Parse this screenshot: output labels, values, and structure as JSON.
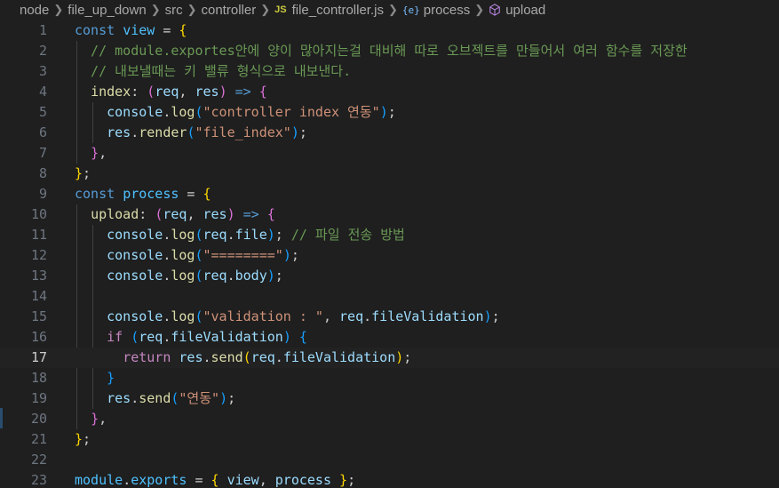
{
  "breadcrumb": {
    "items": [
      "node",
      "file_up_down",
      "src",
      "controller"
    ],
    "file_badge": "JS",
    "file_name": "file_controller.js",
    "symbol_icon": "{e}",
    "symbol1": "process",
    "symbol2": "upload"
  },
  "colors": {
    "background": "#1f1f1f",
    "keyword": "#569cd6",
    "variable": "#9cdcfe",
    "function": "#dcdcaa",
    "string": "#ce9178",
    "comment": "#6a9955",
    "bracket_gold": "#ffd700",
    "bracket_pink": "#da70d6",
    "bracket_blue": "#179fff",
    "flow_keyword": "#c586c0",
    "js_badge": "#cbcb41"
  },
  "editor": {
    "current_line": 17,
    "lines": [
      {
        "n": "1",
        "tokens": [
          {
            "t": "const",
            "c": "#569cd6"
          },
          {
            "t": " ",
            "c": "#cccccc"
          },
          {
            "t": "view",
            "c": "#4fc1ff"
          },
          {
            "t": " = ",
            "c": "#cccccc"
          },
          {
            "t": "{",
            "c": "#ffd700"
          }
        ]
      },
      {
        "n": "2",
        "tokens": [
          {
            "t": "  // module.exportes안에 양이 많아지는걸 대비해 따로 오브젝트를 만들어서 여러 함수를 저장한",
            "c": "#6a9955"
          }
        ]
      },
      {
        "n": "3",
        "tokens": [
          {
            "t": "  // 내보낼때는 키 밸류 형식으로 내보낸다.",
            "c": "#6a9955"
          }
        ]
      },
      {
        "n": "4",
        "tokens": [
          {
            "t": "  ",
            "c": "#cccccc"
          },
          {
            "t": "index",
            "c": "#dcdcaa"
          },
          {
            "t": ": ",
            "c": "#cccccc"
          },
          {
            "t": "(",
            "c": "#da70d6"
          },
          {
            "t": "req",
            "c": "#9cdcfe"
          },
          {
            "t": ", ",
            "c": "#cccccc"
          },
          {
            "t": "res",
            "c": "#9cdcfe"
          },
          {
            "t": ")",
            "c": "#da70d6"
          },
          {
            "t": " ",
            "c": "#cccccc"
          },
          {
            "t": "=>",
            "c": "#569cd6"
          },
          {
            "t": " ",
            "c": "#cccccc"
          },
          {
            "t": "{",
            "c": "#da70d6"
          }
        ]
      },
      {
        "n": "5",
        "tokens": [
          {
            "t": "    ",
            "c": "#cccccc"
          },
          {
            "t": "console",
            "c": "#9cdcfe"
          },
          {
            "t": ".",
            "c": "#cccccc"
          },
          {
            "t": "log",
            "c": "#dcdcaa"
          },
          {
            "t": "(",
            "c": "#179fff"
          },
          {
            "t": "\"controller index 연동\"",
            "c": "#ce9178"
          },
          {
            "t": ")",
            "c": "#179fff"
          },
          {
            "t": ";",
            "c": "#cccccc"
          }
        ]
      },
      {
        "n": "6",
        "tokens": [
          {
            "t": "    ",
            "c": "#cccccc"
          },
          {
            "t": "res",
            "c": "#9cdcfe"
          },
          {
            "t": ".",
            "c": "#cccccc"
          },
          {
            "t": "render",
            "c": "#dcdcaa"
          },
          {
            "t": "(",
            "c": "#179fff"
          },
          {
            "t": "\"file_index\"",
            "c": "#ce9178"
          },
          {
            "t": ")",
            "c": "#179fff"
          },
          {
            "t": ";",
            "c": "#cccccc"
          }
        ]
      },
      {
        "n": "7",
        "tokens": [
          {
            "t": "  ",
            "c": "#cccccc"
          },
          {
            "t": "}",
            "c": "#da70d6"
          },
          {
            "t": ",",
            "c": "#cccccc"
          }
        ]
      },
      {
        "n": "8",
        "tokens": [
          {
            "t": "}",
            "c": "#ffd700"
          },
          {
            "t": ";",
            "c": "#cccccc"
          }
        ]
      },
      {
        "n": "9",
        "tokens": [
          {
            "t": "const",
            "c": "#569cd6"
          },
          {
            "t": " ",
            "c": "#cccccc"
          },
          {
            "t": "process",
            "c": "#4fc1ff"
          },
          {
            "t": " = ",
            "c": "#cccccc"
          },
          {
            "t": "{",
            "c": "#ffd700"
          }
        ]
      },
      {
        "n": "10",
        "tokens": [
          {
            "t": "  ",
            "c": "#cccccc"
          },
          {
            "t": "upload",
            "c": "#dcdcaa"
          },
          {
            "t": ": ",
            "c": "#cccccc"
          },
          {
            "t": "(",
            "c": "#da70d6"
          },
          {
            "t": "req",
            "c": "#9cdcfe"
          },
          {
            "t": ", ",
            "c": "#cccccc"
          },
          {
            "t": "res",
            "c": "#9cdcfe"
          },
          {
            "t": ")",
            "c": "#da70d6"
          },
          {
            "t": " ",
            "c": "#cccccc"
          },
          {
            "t": "=>",
            "c": "#569cd6"
          },
          {
            "t": " ",
            "c": "#cccccc"
          },
          {
            "t": "{",
            "c": "#da70d6"
          }
        ]
      },
      {
        "n": "11",
        "tokens": [
          {
            "t": "    ",
            "c": "#cccccc"
          },
          {
            "t": "console",
            "c": "#9cdcfe"
          },
          {
            "t": ".",
            "c": "#cccccc"
          },
          {
            "t": "log",
            "c": "#dcdcaa"
          },
          {
            "t": "(",
            "c": "#179fff"
          },
          {
            "t": "req",
            "c": "#9cdcfe"
          },
          {
            "t": ".",
            "c": "#cccccc"
          },
          {
            "t": "file",
            "c": "#9cdcfe"
          },
          {
            "t": ")",
            "c": "#179fff"
          },
          {
            "t": "; ",
            "c": "#cccccc"
          },
          {
            "t": "// 파일 전송 방법",
            "c": "#6a9955"
          }
        ]
      },
      {
        "n": "12",
        "tokens": [
          {
            "t": "    ",
            "c": "#cccccc"
          },
          {
            "t": "console",
            "c": "#9cdcfe"
          },
          {
            "t": ".",
            "c": "#cccccc"
          },
          {
            "t": "log",
            "c": "#dcdcaa"
          },
          {
            "t": "(",
            "c": "#179fff"
          },
          {
            "t": "\"========\"",
            "c": "#ce9178"
          },
          {
            "t": ")",
            "c": "#179fff"
          },
          {
            "t": ";",
            "c": "#cccccc"
          }
        ]
      },
      {
        "n": "13",
        "tokens": [
          {
            "t": "    ",
            "c": "#cccccc"
          },
          {
            "t": "console",
            "c": "#9cdcfe"
          },
          {
            "t": ".",
            "c": "#cccccc"
          },
          {
            "t": "log",
            "c": "#dcdcaa"
          },
          {
            "t": "(",
            "c": "#179fff"
          },
          {
            "t": "req",
            "c": "#9cdcfe"
          },
          {
            "t": ".",
            "c": "#cccccc"
          },
          {
            "t": "body",
            "c": "#9cdcfe"
          },
          {
            "t": ")",
            "c": "#179fff"
          },
          {
            "t": ";",
            "c": "#cccccc"
          }
        ]
      },
      {
        "n": "14",
        "tokens": []
      },
      {
        "n": "15",
        "tokens": [
          {
            "t": "    ",
            "c": "#cccccc"
          },
          {
            "t": "console",
            "c": "#9cdcfe"
          },
          {
            "t": ".",
            "c": "#cccccc"
          },
          {
            "t": "log",
            "c": "#dcdcaa"
          },
          {
            "t": "(",
            "c": "#179fff"
          },
          {
            "t": "\"validation : \"",
            "c": "#ce9178"
          },
          {
            "t": ", ",
            "c": "#cccccc"
          },
          {
            "t": "req",
            "c": "#9cdcfe"
          },
          {
            "t": ".",
            "c": "#cccccc"
          },
          {
            "t": "fileValidation",
            "c": "#9cdcfe"
          },
          {
            "t": ")",
            "c": "#179fff"
          },
          {
            "t": ";",
            "c": "#cccccc"
          }
        ]
      },
      {
        "n": "16",
        "tokens": [
          {
            "t": "    ",
            "c": "#cccccc"
          },
          {
            "t": "if",
            "c": "#c586c0"
          },
          {
            "t": " ",
            "c": "#cccccc"
          },
          {
            "t": "(",
            "c": "#179fff"
          },
          {
            "t": "req",
            "c": "#9cdcfe"
          },
          {
            "t": ".",
            "c": "#cccccc"
          },
          {
            "t": "fileValidation",
            "c": "#9cdcfe"
          },
          {
            "t": ")",
            "c": "#179fff"
          },
          {
            "t": " ",
            "c": "#cccccc"
          },
          {
            "t": "{",
            "c": "#179fff"
          }
        ]
      },
      {
        "n": "17",
        "tokens": [
          {
            "t": "      ",
            "c": "#cccccc"
          },
          {
            "t": "return",
            "c": "#c586c0"
          },
          {
            "t": " ",
            "c": "#cccccc"
          },
          {
            "t": "res",
            "c": "#9cdcfe"
          },
          {
            "t": ".",
            "c": "#cccccc"
          },
          {
            "t": "send",
            "c": "#dcdcaa"
          },
          {
            "t": "(",
            "c": "#ffd700"
          },
          {
            "t": "req",
            "c": "#9cdcfe"
          },
          {
            "t": ".",
            "c": "#cccccc"
          },
          {
            "t": "fileValidation",
            "c": "#9cdcfe"
          },
          {
            "t": ")",
            "c": "#ffd700"
          },
          {
            "t": ";",
            "c": "#cccccc"
          }
        ]
      },
      {
        "n": "18",
        "tokens": [
          {
            "t": "    ",
            "c": "#cccccc"
          },
          {
            "t": "}",
            "c": "#179fff"
          }
        ]
      },
      {
        "n": "19",
        "tokens": [
          {
            "t": "    ",
            "c": "#cccccc"
          },
          {
            "t": "res",
            "c": "#9cdcfe"
          },
          {
            "t": ".",
            "c": "#cccccc"
          },
          {
            "t": "send",
            "c": "#dcdcaa"
          },
          {
            "t": "(",
            "c": "#179fff"
          },
          {
            "t": "\"연동\"",
            "c": "#ce9178"
          },
          {
            "t": ")",
            "c": "#179fff"
          },
          {
            "t": ";",
            "c": "#cccccc"
          }
        ]
      },
      {
        "n": "20",
        "tokens": [
          {
            "t": "  ",
            "c": "#cccccc"
          },
          {
            "t": "}",
            "c": "#da70d6"
          },
          {
            "t": ",",
            "c": "#cccccc"
          }
        ]
      },
      {
        "n": "21",
        "tokens": [
          {
            "t": "}",
            "c": "#ffd700"
          },
          {
            "t": ";",
            "c": "#cccccc"
          }
        ]
      },
      {
        "n": "22",
        "tokens": []
      },
      {
        "n": "23",
        "tokens": [
          {
            "t": "module",
            "c": "#4fc1ff"
          },
          {
            "t": ".",
            "c": "#cccccc"
          },
          {
            "t": "exports",
            "c": "#4fc1ff"
          },
          {
            "t": " = ",
            "c": "#cccccc"
          },
          {
            "t": "{",
            "c": "#ffd700"
          },
          {
            "t": " ",
            "c": "#cccccc"
          },
          {
            "t": "view",
            "c": "#9cdcfe"
          },
          {
            "t": ", ",
            "c": "#cccccc"
          },
          {
            "t": "process",
            "c": "#9cdcfe"
          },
          {
            "t": " ",
            "c": "#cccccc"
          },
          {
            "t": "}",
            "c": "#ffd700"
          },
          {
            "t": ";",
            "c": "#cccccc"
          }
        ]
      }
    ]
  }
}
